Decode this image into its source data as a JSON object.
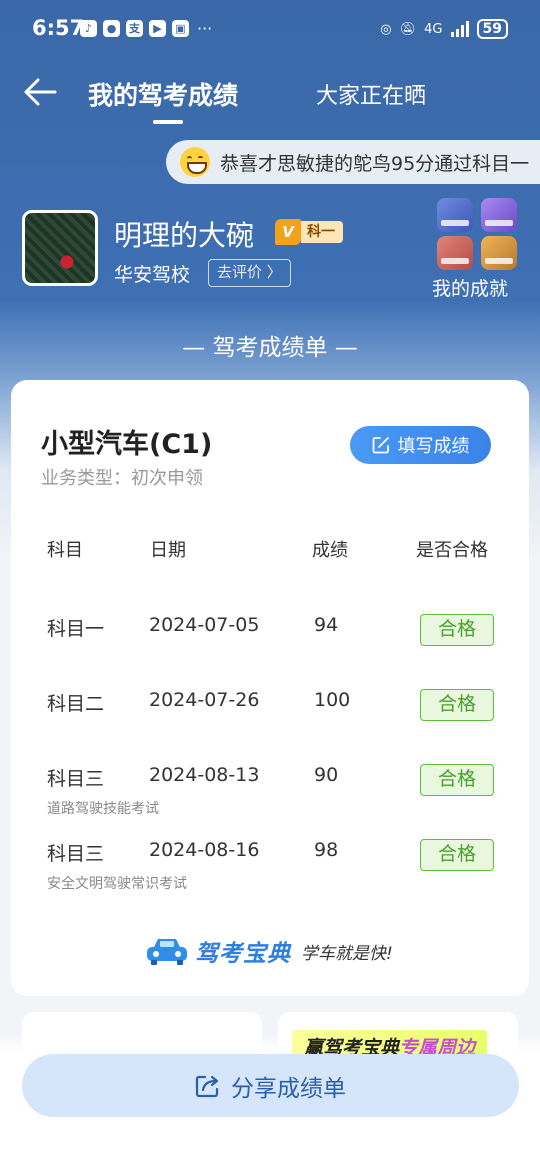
{
  "status_bar": {
    "time": "6:57",
    "apps": [
      "douyin-icon",
      "message-icon",
      "alipay-icon",
      "video-icon",
      "gallery-icon"
    ],
    "more": "···",
    "network": "4G",
    "battery": "59"
  },
  "nav": {
    "title": "我的驾考成绩",
    "second_tab": "大家正在晒"
  },
  "ticker": {
    "text": "恭喜才思敏捷的鸵鸟95分通过科目一"
  },
  "profile": {
    "username": "明理的大碗",
    "vip_label": "科一",
    "school": "华安驾校",
    "rate_label": "去评价 〉",
    "achievements_label": "我的成就"
  },
  "section_title": "— 驾考成绩单 —",
  "card": {
    "vehicle_type": "小型汽车(C1)",
    "business_type": "业务类型：初次申领",
    "fill_button": "填写成绩",
    "headers": {
      "subject": "科目",
      "date": "日期",
      "score": "成绩",
      "passed": "是否合格"
    },
    "rows": [
      {
        "subject": "科目一",
        "date": "2024-07-05",
        "score": "94",
        "status": "合格",
        "note": ""
      },
      {
        "subject": "科目二",
        "date": "2024-07-26",
        "score": "100",
        "status": "合格",
        "note": ""
      },
      {
        "subject": "科目三",
        "date": "2024-08-13",
        "score": "90",
        "status": "合格",
        "note": "道路驾驶技能考试"
      },
      {
        "subject": "科目三",
        "date": "2024-08-16",
        "score": "98",
        "status": "合格",
        "note": "安全文明驾驶常识考试"
      }
    ],
    "brand_name": "驾考宝典",
    "brand_slogan": "学车就是快!"
  },
  "promo": {
    "prefix": "赢驾考宝典",
    "highlight": "专属周边"
  },
  "share_button": "分享成绩单",
  "colors": {
    "primary_blue": "#3a68a8",
    "pass_green": "#49a12c",
    "button_blue": "#3a83e8"
  }
}
